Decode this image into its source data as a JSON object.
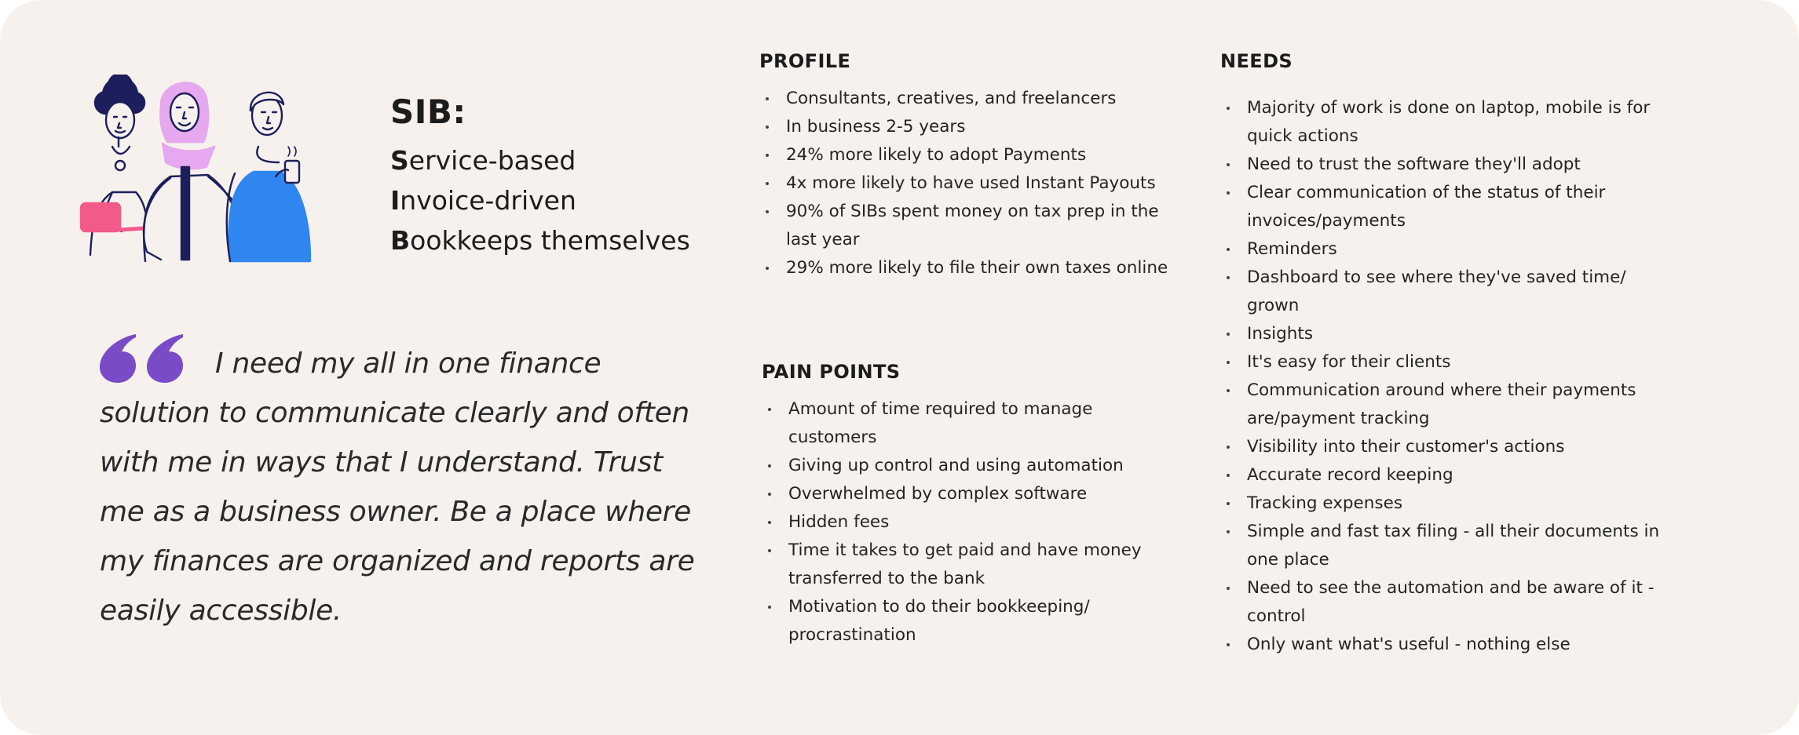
{
  "persona": {
    "title": "SIB:",
    "lines": [
      {
        "initial": "S",
        "rest": "ervice-based"
      },
      {
        "initial": "I",
        "rest": "nvoice-driven"
      },
      {
        "initial": "B",
        "rest": "ookkeeps themselves"
      }
    ]
  },
  "quote": {
    "text": "I need my all in one finance solution to communicate clearly and often with me in ways that I understand. Trust me as a business owner. Be a place where my finances are organized and reports are easily accessible.",
    "mark_color": "#7a4bc6"
  },
  "profile": {
    "heading": "PROFILE",
    "items": [
      "Consultants, creatives, and freelancers",
      "In business 2-5 years",
      "24% more likely to adopt Payments",
      "4x more likely to have used Instant Payouts",
      "90% of SIBs spent money on tax prep in the last year",
      "29% more likely to file their own taxes online"
    ]
  },
  "pain_points": {
    "heading": "PAIN POINTS",
    "items": [
      "Amount of time required to manage customers",
      "Giving up control and using automation",
      "Overwhelmed by complex software",
      "Hidden fees",
      "Time it takes to get paid and have money transferred to the bank",
      "Motivation to do their bookkeeping/ procrastination"
    ]
  },
  "needs": {
    "heading": "NEEDS",
    "items": [
      "Majority of work is done on laptop, mobile is for quick actions",
      "Need to trust the software they'll adopt",
      "Clear communication of the status of their invoices/payments",
      "Reminders",
      "Dashboard to see where they've saved time/ grown",
      "Insights",
      "It's easy for their clients",
      "Communication around where their payments are/payment tracking",
      "Visibility into their customer's actions",
      "Accurate record keeping",
      "Tracking expenses",
      "Simple and fast tax filing - all their documents in one place",
      "Need to see the automation and be aware of it - control",
      "Only want what's useful - nothing else"
    ]
  },
  "colors": {
    "background": "#f6f1ed",
    "laptop_pink": "#f25a8a",
    "hijab_pink": "#e6a8ee",
    "shirt_blue": "#2f86f0",
    "ink_navy": "#1c1f5c"
  }
}
